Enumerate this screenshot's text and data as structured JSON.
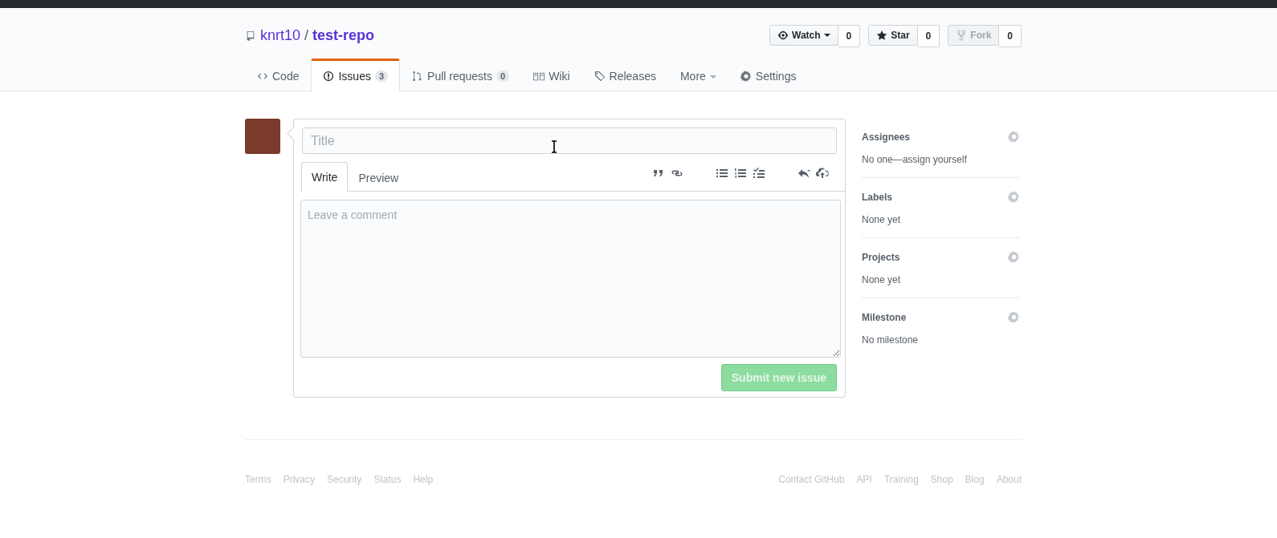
{
  "repo": {
    "owner": "knrt10",
    "separator": "/",
    "name": "test-repo"
  },
  "actions": [
    {
      "label": "Watch",
      "count": "0",
      "caret": true,
      "disabled": false
    },
    {
      "label": "Star",
      "count": "0",
      "caret": false,
      "disabled": false
    },
    {
      "label": "Fork",
      "count": "0",
      "caret": false,
      "disabled": true
    }
  ],
  "tabs": [
    {
      "label": "Code",
      "caret": false,
      "selected": false
    },
    {
      "label": "Issues",
      "count": "3",
      "caret": false,
      "selected": true
    },
    {
      "label": "Pull requests",
      "count": "0",
      "caret": false,
      "selected": false
    },
    {
      "label": "Wiki",
      "caret": false,
      "selected": false
    },
    {
      "label": "Releases",
      "caret": false,
      "selected": false
    },
    {
      "label": "More",
      "caret": true,
      "selected": false
    },
    {
      "label": "Settings",
      "caret": false,
      "selected": false
    }
  ],
  "form": {
    "title_placeholder": "Title",
    "write_tabs": [
      {
        "label": "Write",
        "selected": true
      },
      {
        "label": "Preview",
        "selected": false
      }
    ],
    "comment_placeholder": "Leave a comment",
    "submit": {
      "label": "Submit new issue",
      "disabled": true
    }
  },
  "sidebar": [
    {
      "heading": "Assignees",
      "value": "No one—assign yourself"
    },
    {
      "heading": "Labels",
      "value": "None yet"
    },
    {
      "heading": "Projects",
      "value": "None yet"
    },
    {
      "heading": "Milestone",
      "value": "No milestone"
    }
  ],
  "footer": {
    "left": [
      "Terms",
      "Privacy",
      "Security",
      "Status",
      "Help"
    ],
    "right": [
      "Contact GitHub",
      "API",
      "Training",
      "Shop",
      "Blog",
      "About"
    ]
  }
}
